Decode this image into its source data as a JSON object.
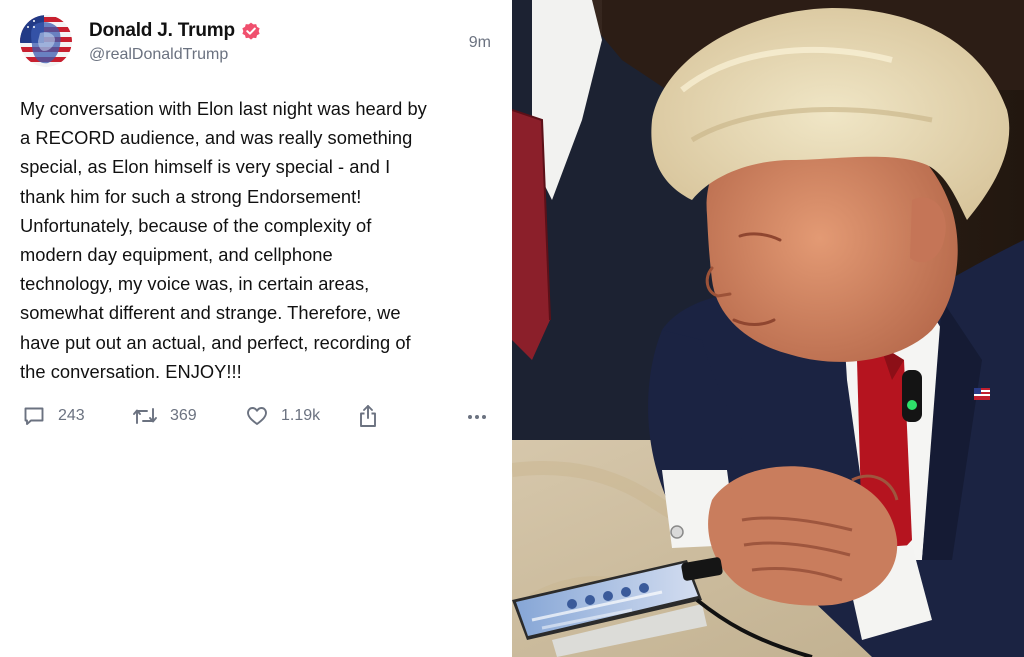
{
  "post": {
    "author": {
      "display_name": "Donald J. Trump",
      "handle": "@realDonaldTrump",
      "avatar_icon": "flag-portrait-avatar",
      "verified_icon": "verified-badge-icon",
      "verified_color": "#f0506e"
    },
    "timestamp": "9m",
    "text": "My conversation with Elon last night was heard by\na RECORD audience, and was really something\nspecial, as Elon himself is very special - and I\nthank him for such a strong Endorsement!\nUnfortunately, because of the complexity of\nmodern day equipment, and cellphone\ntechnology, my voice was, in certain areas,\nsomewhat different and strange. Therefore, we\nhave put out an actual, and perfect, recording of\nthe conversation. ENJOY!!!",
    "actions": {
      "reply": {
        "icon": "reply-bubble-icon",
        "count": "243"
      },
      "retruth": {
        "icon": "retruth-arrows-icon",
        "count": "369"
      },
      "like": {
        "icon": "heart-icon",
        "count": "1.19k"
      },
      "share": {
        "icon": "share-upload-icon"
      },
      "more": {
        "icon": "more-dots-icon"
      }
    }
  },
  "photo": {
    "subject": "man in navy suit with red tie leaning over a smartphone on a table"
  }
}
